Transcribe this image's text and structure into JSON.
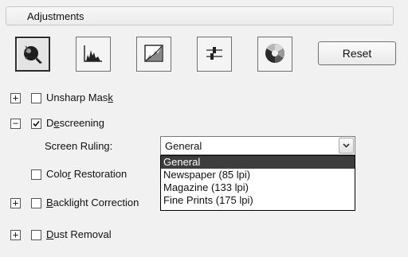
{
  "panel": {
    "title": "Adjustments"
  },
  "toolbar": {
    "buttons": [
      {
        "icon": "auto-exposure-icon",
        "active": true
      },
      {
        "icon": "histogram-icon",
        "active": false
      },
      {
        "icon": "tone-curve-icon",
        "active": false
      },
      {
        "icon": "sliders-icon",
        "active": false
      },
      {
        "icon": "color-palette-icon",
        "active": false
      }
    ],
    "reset_label": "Reset"
  },
  "options": {
    "unsharp_mask": {
      "expander": "+",
      "checked": false,
      "label_a": "Unsharp Mas",
      "label_key": "k",
      "label_b": ""
    },
    "descreening": {
      "expander": "−",
      "checked": true,
      "label_a": "D",
      "label_key": "e",
      "label_b": "screening"
    },
    "screen_ruling": {
      "label": "Screen Ruling:",
      "selected": "General",
      "options": [
        "General",
        "Newspaper (85 lpi)",
        "Magazine (133 lpi)",
        "Fine Prints (175 lpi)"
      ]
    },
    "color_restoration": {
      "checked": false,
      "label_a": "Colo",
      "label_key": "r",
      "label_b": " Restoration"
    },
    "backlight_correction": {
      "expander": "+",
      "checked": false,
      "label_a": "",
      "label_key": "B",
      "label_b": "acklight Correction"
    },
    "dust_removal": {
      "expander": "+",
      "checked": false,
      "label_a": "",
      "label_key": "D",
      "label_b": "ust Removal"
    }
  }
}
